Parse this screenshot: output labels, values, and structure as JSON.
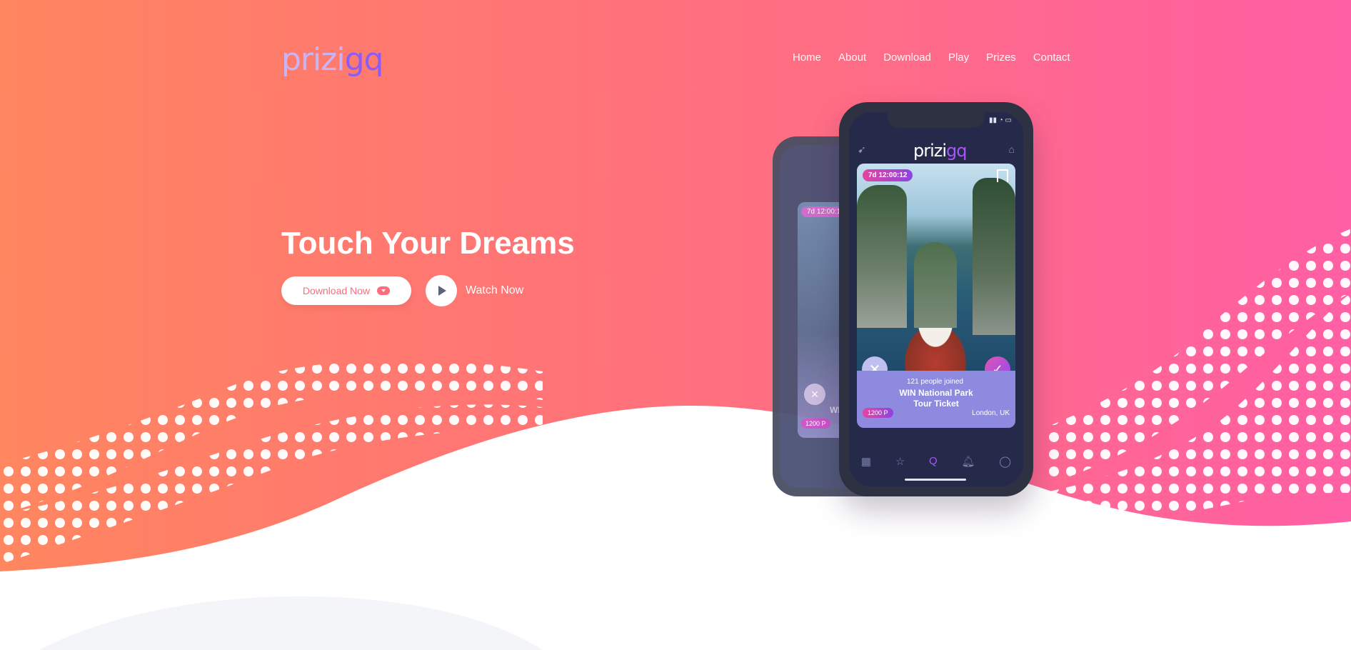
{
  "brand": {
    "logo_part1": "prizi",
    "logo_part2": "gq"
  },
  "nav": {
    "items": [
      "Home",
      "About",
      "Download",
      "Play",
      "Prizes",
      "Contact"
    ]
  },
  "hero": {
    "headline": "Touch Your Dreams",
    "download_label": "Download Now",
    "watch_label": "Watch Now"
  },
  "phone": {
    "app_logo_part1": "prizi",
    "app_logo_part2": "gq",
    "timer_tag": "7d 12:00:12",
    "joined_text": "121 people joined",
    "title_line1": "WIN National Park",
    "title_line2": "Tour Ticket",
    "cost_tag": "1200 P",
    "location": "London, UK"
  },
  "phone_back": {
    "timer_tag": "7d 12:00:12",
    "cost_tag": "1200 P",
    "partial_title": "WI"
  },
  "icons": [
    "cloud-download-icon",
    "play-icon",
    "rocket-icon",
    "home-icon",
    "bookmark-icon",
    "close-icon",
    "check-icon",
    "grid-icon",
    "star-icon",
    "search-icon",
    "bell-icon",
    "user-icon"
  ],
  "colors": {
    "gradient_left": "#ff865f",
    "gradient_right": "#ff5fa4",
    "accent_purple": "#8b5cf6",
    "app_bg": "#25294a"
  }
}
